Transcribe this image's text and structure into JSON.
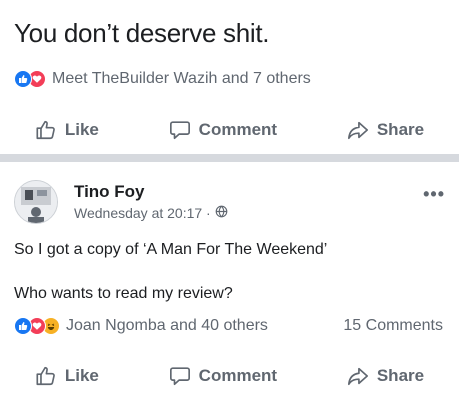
{
  "post1": {
    "text": "You don’t deserve shit.",
    "reactions_text": "Meet TheBuilder Wazih and 7 others",
    "reaction_icons": [
      "like-icon",
      "love-icon"
    ]
  },
  "actions": {
    "like": "Like",
    "comment": "Comment",
    "share": "Share"
  },
  "post2": {
    "author": "Tino Foy",
    "timestamp": "Wednesday at 20:17 ·",
    "privacy_icon": "globe-icon",
    "line1": "So I got a copy of ‘A Man For The Weekend’",
    "line2": "Who wants to read my review?",
    "reactions_text": "Joan Ngomba and 40 others",
    "reaction_icons": [
      "like-icon",
      "love-icon",
      "haha-icon"
    ],
    "comments_count": "15 Comments"
  },
  "colors": {
    "like_blue": "#1877f2",
    "love_red": "#f33e58",
    "haha_yellow": "#f7b125",
    "secondary_text": "#606770",
    "separator": "#d6d9de"
  }
}
